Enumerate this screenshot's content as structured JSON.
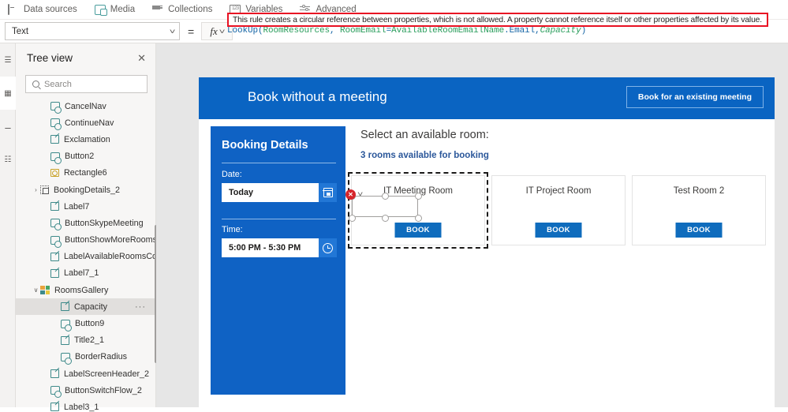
{
  "menubar": {
    "items": [
      {
        "label": "Data sources",
        "icon": "database-icon"
      },
      {
        "label": "Media",
        "icon": "media-icon"
      },
      {
        "label": "Collections",
        "icon": "collections-icon"
      },
      {
        "label": "Variables",
        "icon": "variables-icon"
      },
      {
        "label": "Advanced",
        "icon": "advanced-icon"
      }
    ]
  },
  "formula_bar": {
    "property_value": "Text",
    "equals": "=",
    "fx_label": "fx",
    "formula_tokens": [
      {
        "text": "LookUp(",
        "style": "fn"
      },
      {
        "text": "RoomResources",
        "style": "ident"
      },
      {
        "text": ", ",
        "style": "plain"
      },
      {
        "text": "RoomEmail",
        "style": "ident"
      },
      {
        "text": "=",
        "style": "plain"
      },
      {
        "text": "AvailableRoomEmailName",
        "style": "ident"
      },
      {
        "text": ".Email",
        "style": "plain"
      },
      {
        "text": ",",
        "style": "plain"
      },
      {
        "text": "Capacity",
        "style": "italic"
      },
      {
        "text": ")",
        "style": "plain"
      }
    ],
    "error_message": "This rule creates a circular reference between properties, which is not allowed. A property cannot reference itself or other properties affected by its value.",
    "error_color": "#e81123"
  },
  "tree_view": {
    "title": "Tree view",
    "close_label": "✕",
    "search_placeholder": "Search",
    "nodes": [
      {
        "label": "CancelNav",
        "icon": "button-node-icon",
        "indent": 1,
        "caret": "",
        "selected": false
      },
      {
        "label": "ContinueNav",
        "icon": "button-node-icon",
        "indent": 1,
        "caret": "",
        "selected": false
      },
      {
        "label": "Exclamation",
        "icon": "label-node-icon",
        "indent": 1,
        "caret": "",
        "selected": false
      },
      {
        "label": "Button2",
        "icon": "button-node-icon",
        "indent": 1,
        "caret": "",
        "selected": false
      },
      {
        "label": "Rectangle6",
        "icon": "rect-node-icon",
        "indent": 1,
        "caret": "",
        "selected": false
      },
      {
        "label": "BookingDetails_2",
        "icon": "group-node-icon",
        "indent": 0,
        "caret": "›",
        "selected": false
      },
      {
        "label": "Label7",
        "icon": "label-node-icon",
        "indent": 1,
        "caret": "",
        "selected": false
      },
      {
        "label": "ButtonSkypeMeeting",
        "icon": "button-node-icon",
        "indent": 1,
        "caret": "",
        "selected": false
      },
      {
        "label": "ButtonShowMoreRooms",
        "icon": "button-node-icon",
        "indent": 1,
        "caret": "",
        "selected": false
      },
      {
        "label": "LabelAvailableRoomsCount",
        "icon": "label-node-icon",
        "indent": 1,
        "caret": "",
        "selected": false
      },
      {
        "label": "Label7_1",
        "icon": "label-node-icon",
        "indent": 1,
        "caret": "",
        "selected": false
      },
      {
        "label": "RoomsGallery",
        "icon": "gallery-node-icon",
        "indent": 0,
        "caret": "∨",
        "selected": false
      },
      {
        "label": "Capacity",
        "icon": "label-node-icon",
        "indent": 2,
        "caret": "",
        "selected": true,
        "overflow": "···"
      },
      {
        "label": "Button9",
        "icon": "button-node-icon",
        "indent": 2,
        "caret": "",
        "selected": false
      },
      {
        "label": "Title2_1",
        "icon": "label-node-icon",
        "indent": 2,
        "caret": "",
        "selected": false
      },
      {
        "label": "BorderRadius",
        "icon": "button-node-icon",
        "indent": 2,
        "caret": "",
        "selected": false
      },
      {
        "label": "LabelScreenHeader_2",
        "icon": "label-node-icon",
        "indent": 1,
        "caret": "",
        "selected": false
      },
      {
        "label": "ButtonSwitchFlow_2",
        "icon": "button-node-icon",
        "indent": 1,
        "caret": "",
        "selected": false
      },
      {
        "label": "Label3_1",
        "icon": "label-node-icon",
        "indent": 1,
        "caret": "",
        "selected": false
      }
    ]
  },
  "canvas": {
    "header": {
      "title": "Book without a meeting",
      "existing_meeting_button": "Book for an existing meeting",
      "background": "#0a64c2"
    },
    "booking_panel": {
      "title": "Booking Details",
      "date_label": "Date:",
      "date_value": "Today",
      "date_icon": "calendar-icon",
      "time_label": "Time:",
      "time_value": "5:00 PM - 5:30 PM",
      "time_icon": "clock-icon",
      "background": "#0f62c4"
    },
    "rooms": {
      "heading": "Select an available room:",
      "count_text": "3 rooms available for booking",
      "book_label": "BOOK",
      "cards": [
        {
          "name": "IT Meeting Room",
          "selected": true
        },
        {
          "name": "IT Project Room",
          "selected": false
        },
        {
          "name": "Test Room 2",
          "selected": false
        }
      ],
      "error_badge": "✕",
      "accent": "#0f6cbd"
    }
  }
}
